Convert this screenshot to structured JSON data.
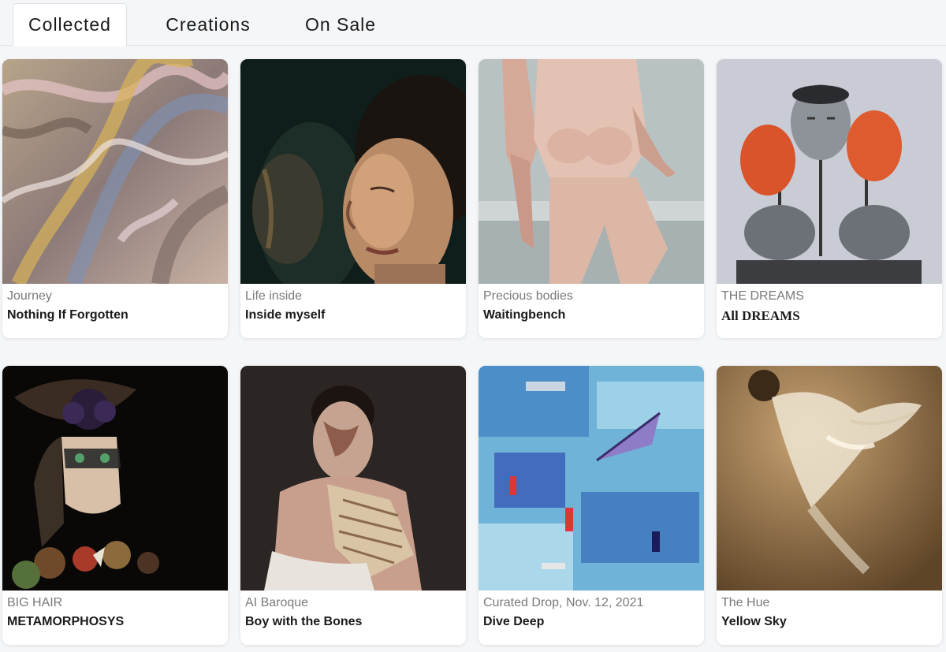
{
  "tabs": [
    {
      "label": "Collected",
      "active": true
    },
    {
      "label": "Creations",
      "active": false
    },
    {
      "label": "On Sale",
      "active": false
    }
  ],
  "cards": [
    {
      "collection": "Journey",
      "title": "Nothing If Forgotten",
      "artwork": "abstract-fiber-texture"
    },
    {
      "collection": "Life inside",
      "title": "Inside myself",
      "artwork": "portrait-woman-profile"
    },
    {
      "collection": "Precious bodies",
      "title": "Waitingbench",
      "artwork": "seated-nude-figure"
    },
    {
      "collection": "THE DREAMS",
      "title": "All DREAMS",
      "artwork": "sculpted-heads"
    },
    {
      "collection": "BIG HAIR",
      "title": "METAMORPHOSYS",
      "artwork": "masked-figure-with-fruit"
    },
    {
      "collection": "AI Baroque",
      "title": "Boy with the Bones",
      "artwork": "boy-with-skeleton"
    },
    {
      "collection": "Curated Drop, Nov. 12, 2021",
      "title": "Dive Deep",
      "artwork": "blue-abstract-painting"
    },
    {
      "collection": "The Hue",
      "title": "Yellow Sky",
      "artwork": "feathered-bird-sepia"
    }
  ]
}
